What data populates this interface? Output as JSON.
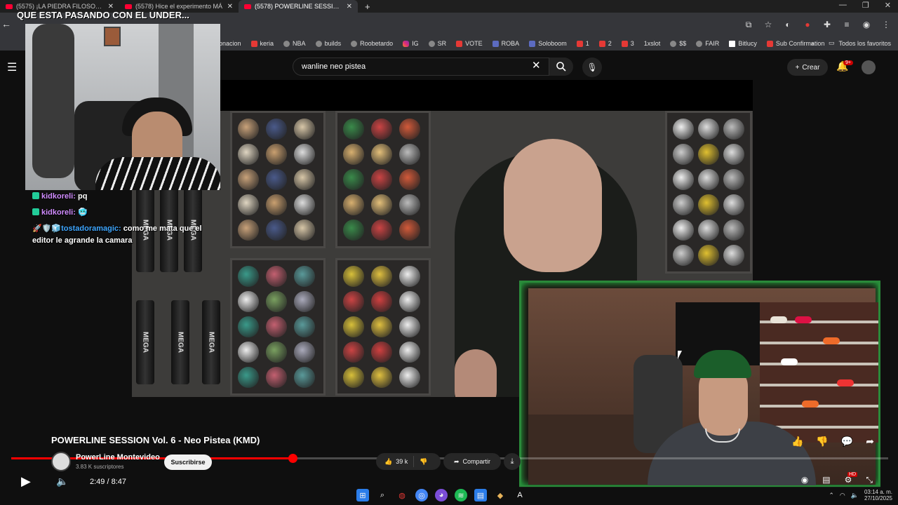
{
  "browser": {
    "tabs": [
      {
        "label": "(5575) ¡LA PIEDRA FILOSOFAL |",
        "active": false
      },
      {
        "label": "(5578) Hice el experimento MÁ",
        "active": false
      },
      {
        "label": "(5578) POWERLINE SESSION Vo",
        "active": true
      }
    ],
    "new_tab_glyph": "+",
    "bookmarks": [
      {
        "label": "onacion",
        "icon": "generic"
      },
      {
        "label": "keria",
        "icon": "youtube"
      },
      {
        "label": "NBA",
        "icon": "nba"
      },
      {
        "label": "builds",
        "icon": "builds"
      },
      {
        "label": "Roobetardo",
        "icon": "generic"
      },
      {
        "label": "IG",
        "icon": "instagram"
      },
      {
        "label": "SR",
        "icon": "generic"
      },
      {
        "label": "VOTE",
        "icon": "generic"
      },
      {
        "label": "ROBA",
        "icon": "generic"
      },
      {
        "label": "Soloboom",
        "icon": "generic"
      },
      {
        "label": "1",
        "icon": "youtube"
      },
      {
        "label": "2",
        "icon": "youtube"
      },
      {
        "label": "3",
        "icon": "youtube"
      },
      {
        "label": "1xslot",
        "icon": "generic"
      },
      {
        "label": "$$",
        "icon": "generic"
      },
      {
        "label": "FAIR",
        "icon": "generic"
      },
      {
        "label": "Bitlucy",
        "icon": "white"
      },
      {
        "label": "Sub Confirmation",
        "icon": "youtube"
      }
    ],
    "all_bookmarks_label": "Todos los favoritos"
  },
  "stream": {
    "title": "QUE ESTA PASANDO CON EL UNDER...",
    "chat": [
      {
        "user": "kidkoreli:",
        "text": "pq"
      },
      {
        "user": "kidkoreli:",
        "text": ""
      },
      {
        "user": "tostadoramagic:",
        "text": "como me mata que el editor le agrande la camara"
      }
    ]
  },
  "youtube": {
    "search_value": "wanline neo pistea",
    "create_label": "Crear",
    "notification_badge": "9+",
    "video_title": "POWERLINE SESSION Vol. 6 - Neo Pistea (KMD)",
    "channel_name": "PowerLine Montevideo",
    "subscribers": "3.83 K suscriptores",
    "subscribe_label": "Suscribirse",
    "likes": "39 k",
    "share_label": "Compartir",
    "time": "2:49 / 8:47",
    "progress_fraction": 0.321
  },
  "taskbar": {
    "clock_time": "03:14 a. m.",
    "clock_date": "27/10/2025"
  },
  "colors": {
    "accent_red": "#ff0000",
    "webcam_border": "#2a8a3a"
  }
}
